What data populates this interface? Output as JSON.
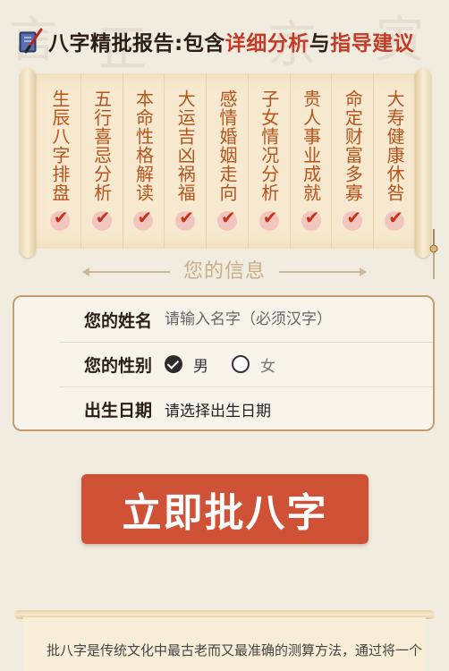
{
  "header": {
    "title_part1": "八字精批报告:包含",
    "title_part2": "详细分析",
    "title_part3": "与",
    "title_part4": "指导建议"
  },
  "scroll": {
    "items": [
      {
        "label": "生辰八字排盘"
      },
      {
        "label": "五行喜忌分析"
      },
      {
        "label": "本命性格解读"
      },
      {
        "label": "大运吉凶祸福"
      },
      {
        "label": "感情婚姻走向"
      },
      {
        "label": "子女情况分析"
      },
      {
        "label": "贵人事业成就"
      },
      {
        "label": "命定财富多寡"
      },
      {
        "label": "大寿健康休咎"
      }
    ]
  },
  "info_section": {
    "title": "您的信息"
  },
  "form": {
    "name_label": "您的姓名",
    "name_placeholder": "请输入名字（必须汉字）",
    "name_value": "",
    "gender_label": "您的性别",
    "gender_options": [
      {
        "label": "男",
        "selected": true
      },
      {
        "label": "女",
        "selected": false
      }
    ],
    "birth_label": "出生日期",
    "birth_placeholder": "请选择出生日期"
  },
  "submit": {
    "label": "立即批八字"
  },
  "intro": {
    "text": "批八字是传统文化中最古老而又最准确的测算方法，通过将一个"
  },
  "colors": {
    "accent_red": "#c43b26",
    "button_bg": "#cf5236",
    "scroll_text": "#b5541c",
    "page_bg": "#f1ece0"
  }
}
